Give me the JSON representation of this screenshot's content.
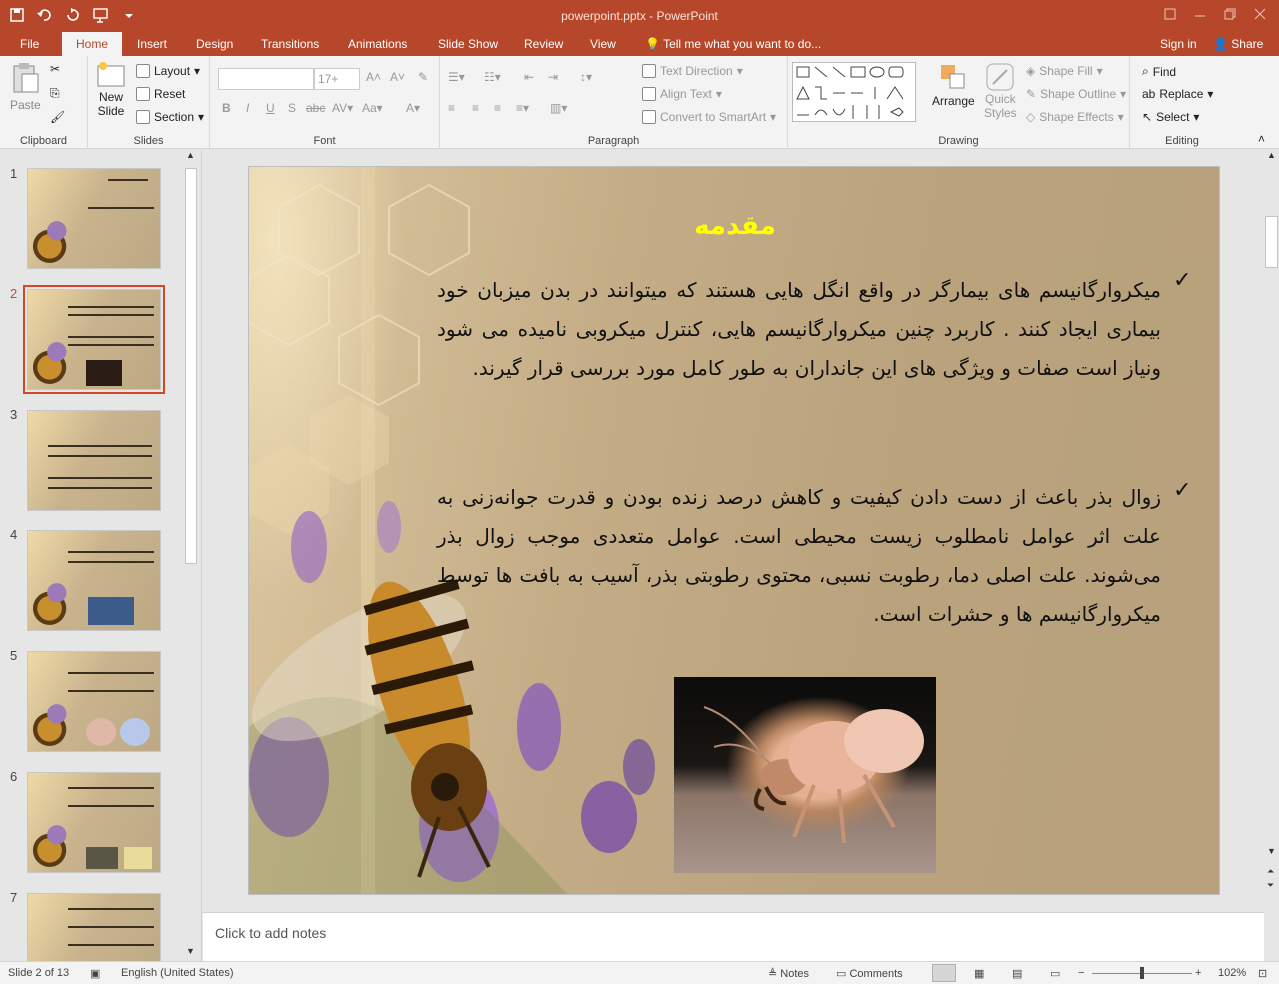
{
  "window": {
    "title": "powerpoint.pptx - PowerPoint"
  },
  "tabs": [
    "File",
    "Home",
    "Insert",
    "Design",
    "Transitions",
    "Animations",
    "Slide Show",
    "Review",
    "View"
  ],
  "active_tab": "Home",
  "tell_me": "Tell me what you want to do...",
  "account": {
    "sign_in": "Sign in",
    "share": "Share"
  },
  "ribbon": {
    "clipboard": {
      "label": "Clipboard",
      "paste": "Paste"
    },
    "slides": {
      "label": "Slides",
      "new_slide": "New",
      "new_slide2": "Slide",
      "layout": "Layout",
      "reset": "Reset",
      "section": "Section"
    },
    "font": {
      "label": "Font",
      "size": "17+"
    },
    "paragraph": {
      "label": "Paragraph",
      "text_direction": "Text Direction",
      "align_text": "Align Text",
      "convert_smartart": "Convert to SmartArt"
    },
    "drawing": {
      "label": "Drawing",
      "arrange": "Arrange",
      "quick_styles": "Quick",
      "quick_styles2": "Styles",
      "shape_fill": "Shape Fill",
      "shape_outline": "Shape Outline",
      "shape_effects": "Shape Effects"
    },
    "editing": {
      "label": "Editing",
      "find": "Find",
      "replace": "Replace",
      "select": "Select"
    }
  },
  "thumbnails": [
    "1",
    "2",
    "3",
    "4",
    "5",
    "6",
    "7"
  ],
  "slide": {
    "title": "مقدمه",
    "bullets": [
      "میکروارگانیسم های بیمارگر در واقع انگل هایی هستند که میتوانند در بدن میزبان خود بیماری ایجاد کنند . کاربرد چنین میکروارگانیسم هایی، کنترل میکروبی نامیده می شود ونیاز است صفات و ویژگی های این جانداران به طور کامل مورد بررسی قرار گیرند.",
      "زوال بذر باعث از دست دادن کیفیت و کاهش درصد زنده بودن و قدرت جوانه‌زنی به علت اثر عوامل نامطلوب زیست محیطی است. عوامل متعددی موجب زوال بذر می‌شوند. علت اصلی دما، رطوبت نسبی، محتوی رطوبتی بذر، آسیب به بافت ها توسط میکروارگانیسم ها و حشرات است."
    ],
    "check": "✓"
  },
  "notes_placeholder": "Click to add notes",
  "status": {
    "slide": "Slide 2 of 13",
    "language": "English (United States)",
    "notes": "Notes",
    "comments": "Comments",
    "zoom": "102%"
  }
}
